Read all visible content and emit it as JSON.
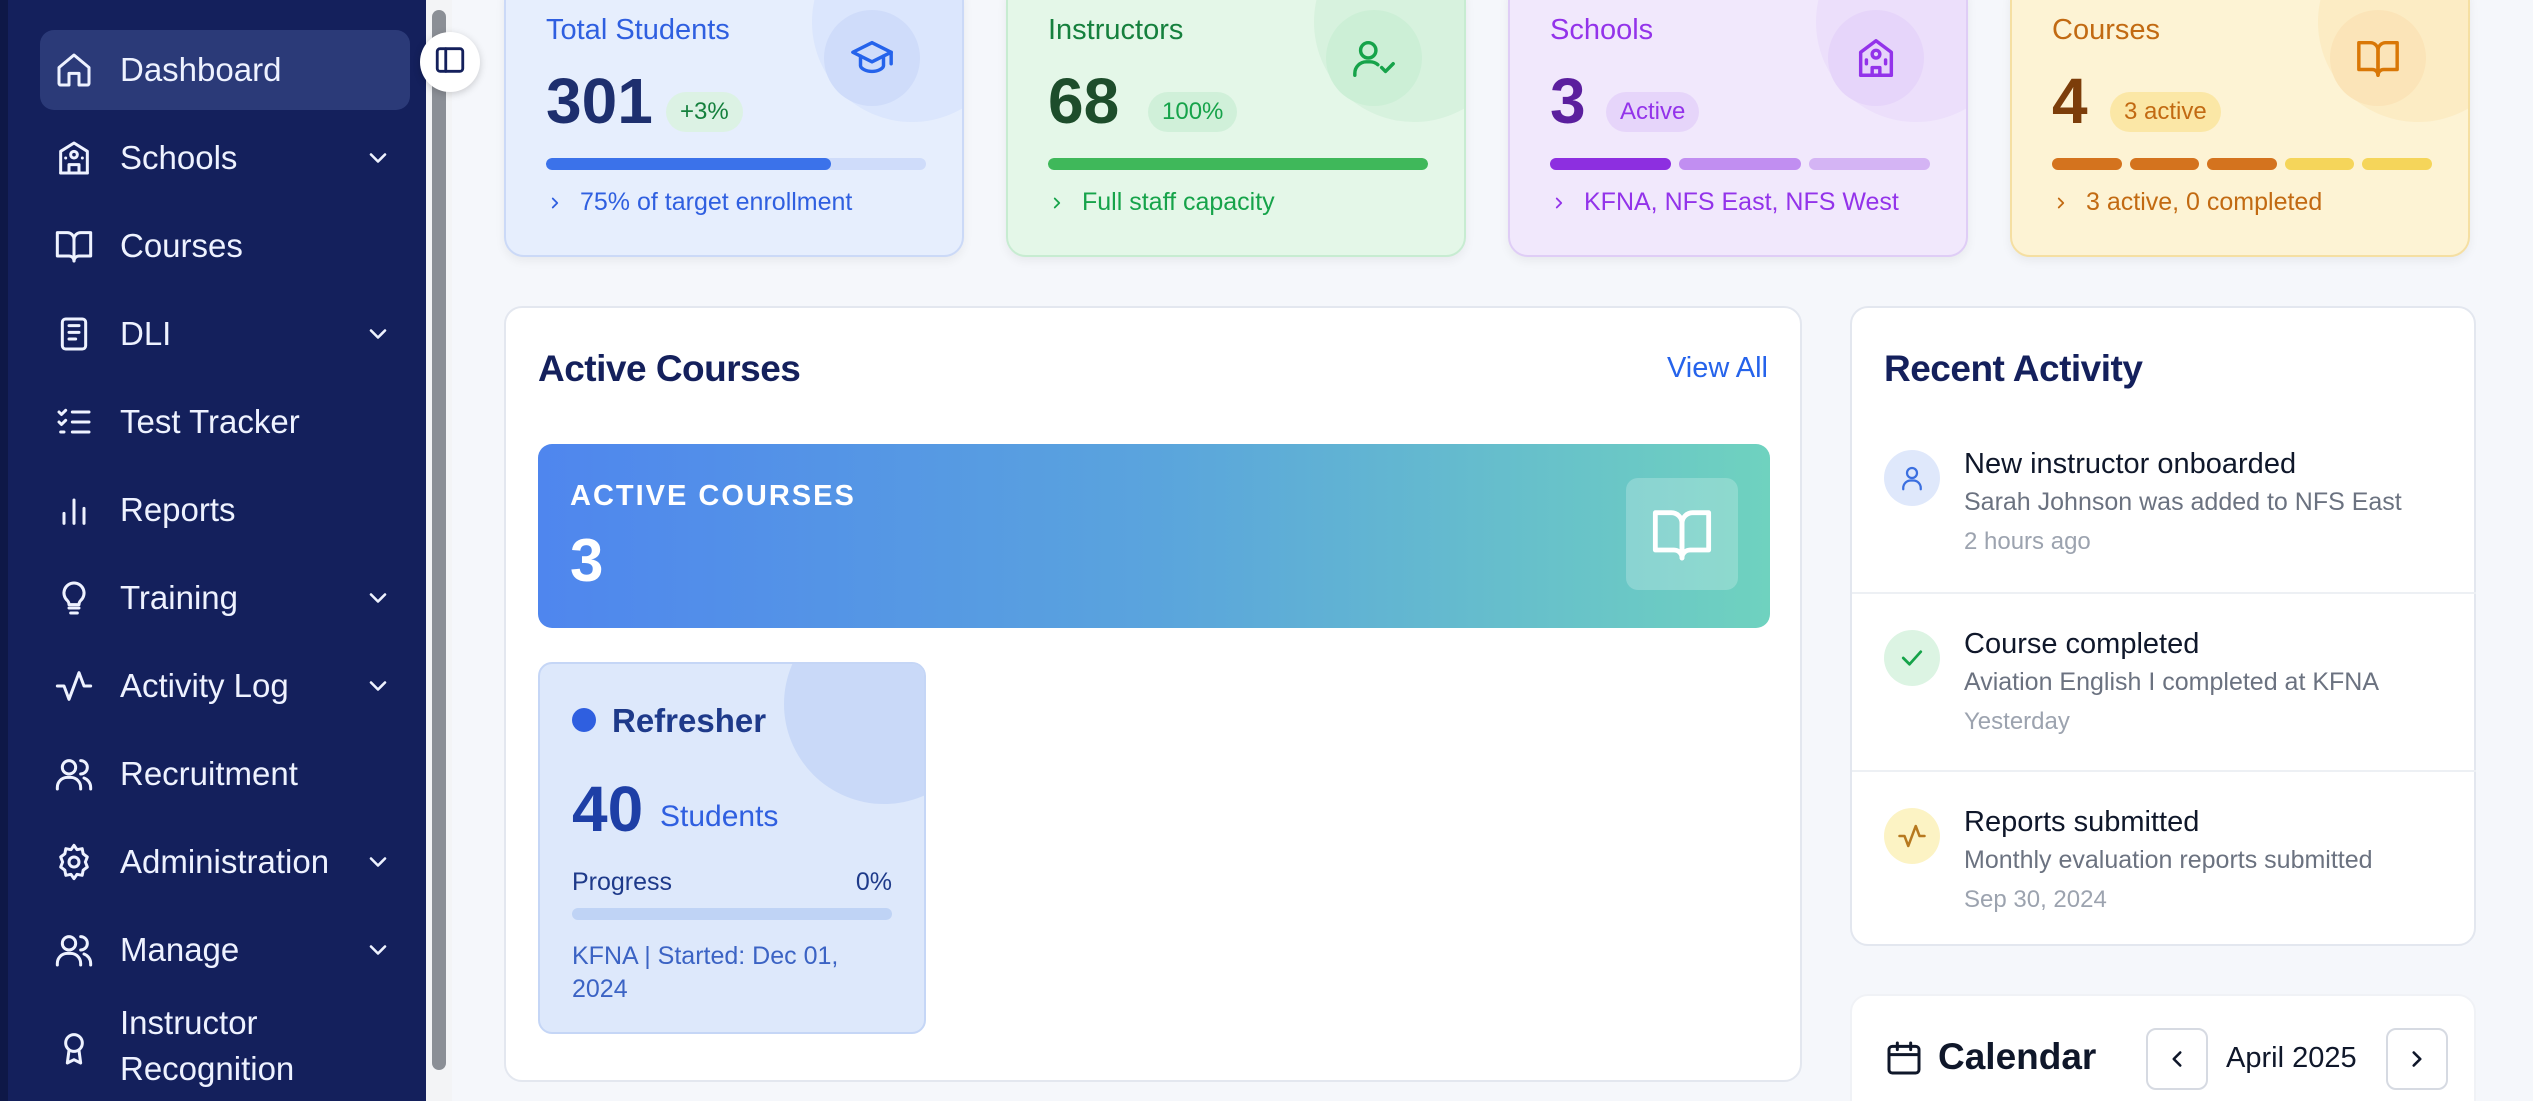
{
  "sidebar": {
    "items": [
      {
        "label": "Dashboard",
        "icon": "home-icon",
        "active": true,
        "expandable": false
      },
      {
        "label": "Schools",
        "icon": "building-icon",
        "expandable": true
      },
      {
        "label": "Courses",
        "icon": "book-open-icon",
        "expandable": false
      },
      {
        "label": "DLI",
        "icon": "book-icon",
        "expandable": true
      },
      {
        "label": "Test Tracker",
        "icon": "list-checks-icon",
        "expandable": false
      },
      {
        "label": "Reports",
        "icon": "bar-chart-icon",
        "expandable": false
      },
      {
        "label": "Training",
        "icon": "lightbulb-icon",
        "expandable": true
      },
      {
        "label": "Activity Log",
        "icon": "activity-icon",
        "expandable": true
      },
      {
        "label": "Recruitment",
        "icon": "users-icon",
        "expandable": false
      },
      {
        "label": "Administration",
        "icon": "gear-icon",
        "expandable": true
      },
      {
        "label": "Manage",
        "icon": "users-icon",
        "expandable": true
      },
      {
        "label": "Instructor Recognition",
        "icon": "award-icon",
        "expandable": false
      }
    ]
  },
  "stats": [
    {
      "title": "Total Students",
      "value": "301",
      "badge": "+3%",
      "footer": "75% of target enrollment",
      "progress": 0.75,
      "icon": "graduation-cap-icon",
      "accent": "#2563eb"
    },
    {
      "title": "Instructors",
      "value": "68",
      "badge": "100%",
      "footer": "Full staff capacity",
      "progress": 1.0,
      "icon": "user-check-icon",
      "accent": "#16a34a"
    },
    {
      "title": "Schools",
      "value": "3",
      "badge": "Active",
      "footer": "KFNA, NFS East, NFS West",
      "segments": 3,
      "icon": "school-icon",
      "accent": "#9333ea"
    },
    {
      "title": "Courses",
      "value": "4",
      "badge": "3 active",
      "footer": "3 active, 0 completed",
      "segments": 5,
      "icon": "book-open-icon",
      "accent": "#d97706"
    }
  ],
  "active_courses": {
    "title": "Active Courses",
    "view_all": "View All",
    "banner_label": "ACTIVE COURSES",
    "banner_value": "3",
    "course": {
      "name": "Refresher",
      "students": "40",
      "students_label": "Students",
      "progress_label": "Progress",
      "progress_value": "0%",
      "progress": 0,
      "meta": "KFNA | Started: Dec 01, 2024"
    }
  },
  "recent_activity": {
    "title": "Recent Activity",
    "items": [
      {
        "title": "New instructor onboarded",
        "desc": "Sarah Johnson was added to NFS East",
        "time": "2 hours ago",
        "icon": "user-icon"
      },
      {
        "title": "Course completed",
        "desc": "Aviation English I completed at KFNA",
        "time": "Yesterday",
        "icon": "check-icon"
      },
      {
        "title": "Reports submitted",
        "desc": "Monthly evaluation reports submitted",
        "time": "Sep 30, 2024",
        "icon": "activity-icon"
      }
    ]
  },
  "calendar": {
    "title": "Calendar",
    "month": "April 2025"
  }
}
